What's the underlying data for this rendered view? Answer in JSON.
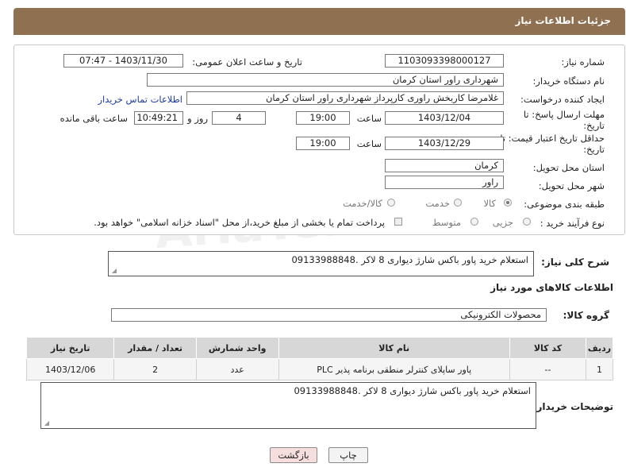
{
  "header": {
    "title": "جزئیات اطلاعات نیاز"
  },
  "form": {
    "need_number": {
      "label": "شماره نیاز:",
      "value": "1103093398000127"
    },
    "announce_datetime": {
      "label": "تاریخ و ساعت اعلان عمومی:",
      "value": "1403/11/30 - 07:47"
    },
    "buyer_org": {
      "label": "نام دستگاه خریدار:",
      "value": "شهرداری راور استان کرمان"
    },
    "requester": {
      "label": "ایجاد کننده درخواست:",
      "value": "غلامرضا کاربخش راوری کارپرداز  شهرداری راور استان کرمان",
      "contact_link": "اطلاعات تماس خریدار"
    },
    "reply_deadline": {
      "label": "مهلت ارسال پاسخ: تا",
      "label2": "تاریخ:",
      "date": "1403/12/04",
      "time_label": "ساعت",
      "time": "19:00",
      "days": "4",
      "days_label": "روز و",
      "remaining": "10:49:21",
      "remaining_label": "ساعت باقی مانده"
    },
    "price_validity": {
      "label": "حداقل تاریخ اعتبار قیمت: تا",
      "label2": "تاریخ:",
      "date": "1403/12/29",
      "time_label": "ساعت",
      "time": "19:00"
    },
    "province": {
      "label": "استان محل تحویل:",
      "value": "کرمان"
    },
    "city": {
      "label": "شهر محل تحویل:",
      "value": "راور"
    },
    "category": {
      "label": "طبقه بندی موضوعی:",
      "options": [
        "کالا",
        "خدمت",
        "کالا/خدمت"
      ],
      "selected": "کالا"
    },
    "purchase_type": {
      "label": "نوع فرآیند خرید :",
      "options": [
        "جزیی",
        "متوسط"
      ],
      "note": "پرداخت تمام یا بخشی از مبلغ خرید،از محل \"اسناد خزانه اسلامی\" خواهد بود."
    }
  },
  "description": {
    "label": "شرح کلی نیاز:",
    "value": "استعلام خرید پاور باکس شارژ دیواری 8 لاکر .09133988848"
  },
  "goods_section": {
    "title": "اطلاعات کالاهای مورد نیاز",
    "group_label": "گروه کالا:",
    "group_value": "محصولات الکترونیکی"
  },
  "table": {
    "headers": [
      "ردیف",
      "کد کالا",
      "نام کالا",
      "واحد شمارش",
      "تعداد / مقدار",
      "تاریخ نیاز"
    ],
    "rows": [
      [
        "1",
        "--",
        "پاور ساپلای کنترلر منطقی برنامه پذیر PLC",
        "عدد",
        "2",
        "1403/12/06"
      ]
    ]
  },
  "buyer_notes": {
    "label": "توضیحات خریدار:",
    "value": "استعلام خرید پاور باکس شارژ دیواری 8 لاکر .09133988848"
  },
  "buttons": {
    "print": "چاپ",
    "back": "بازگشت"
  },
  "watermark": "AriaTender.net",
  "colors": {
    "header_bg": "#8f7152",
    "link": "#1a3d9e",
    "back_btn_bg": "#f6dede"
  }
}
